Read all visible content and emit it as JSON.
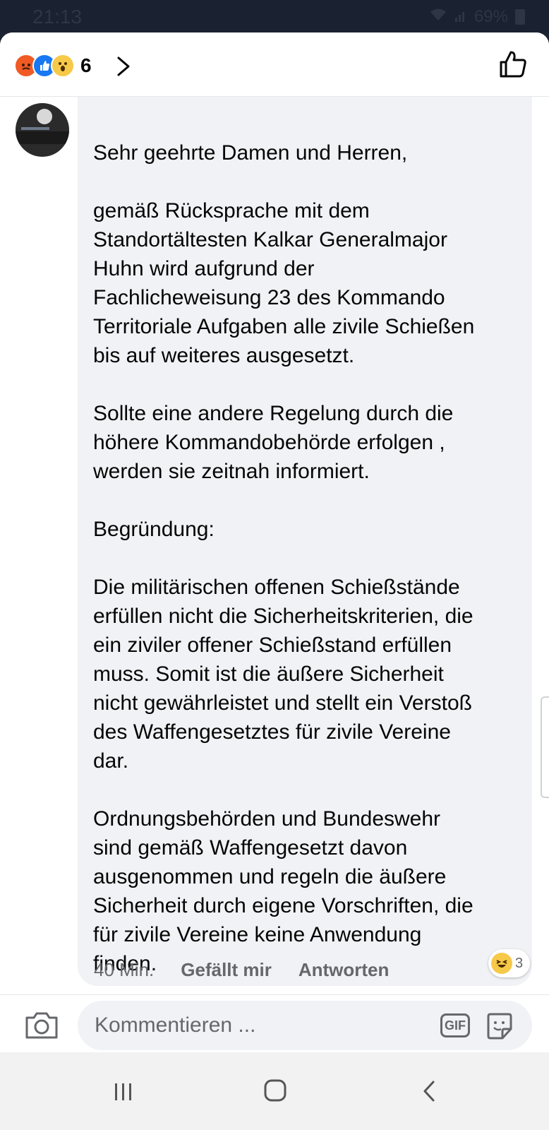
{
  "status_bar": {
    "time": "21:13",
    "battery": "69%"
  },
  "header": {
    "reaction_count": "6",
    "reaction_icons": [
      "angry-reaction",
      "like-reaction",
      "wow-reaction"
    ]
  },
  "comment": {
    "body": "Sehr geehrte Damen und Herren,\n\ngemäß Rücksprache mit dem\nStandortältesten Kalkar Generalmajor\nHuhn wird aufgrund der\nFachlicheweisung 23 des Kommando\nTerritoriale Aufgaben alle zivile Schießen\nbis auf weiteres ausgesetzt.\n\nSollte eine andere Regelung durch die\nhöhere Kommandobehörde erfolgen ,\nwerden sie zeitnah informiert.\n\nBegründung:\n\nDie militärischen offenen Schießstände\nerfüllen nicht die Sicherheitskriterien, die\nein ziviler offener Schießstand erfüllen\nmuss. Somit ist die äußere Sicherheit\nnicht gewährleistet und stellt ein Verstoß\ndes Waffengesetztes für zivile Vereine\ndar.\n\nOrdnungsbehörden und Bundeswehr\nsind gemäß Waffengesetzt davon\nausgenommen und regeln die äußere\nSicherheit durch eigene Vorschriften, die\nfür zivile Vereine keine Anwendung\nfinden.",
    "time": "40 Min.",
    "like_label": "Gefällt mir",
    "reply_label": "Antworten",
    "haha_count": "3"
  },
  "composer": {
    "placeholder": "Kommentieren ...",
    "gif_label": "GIF"
  }
}
